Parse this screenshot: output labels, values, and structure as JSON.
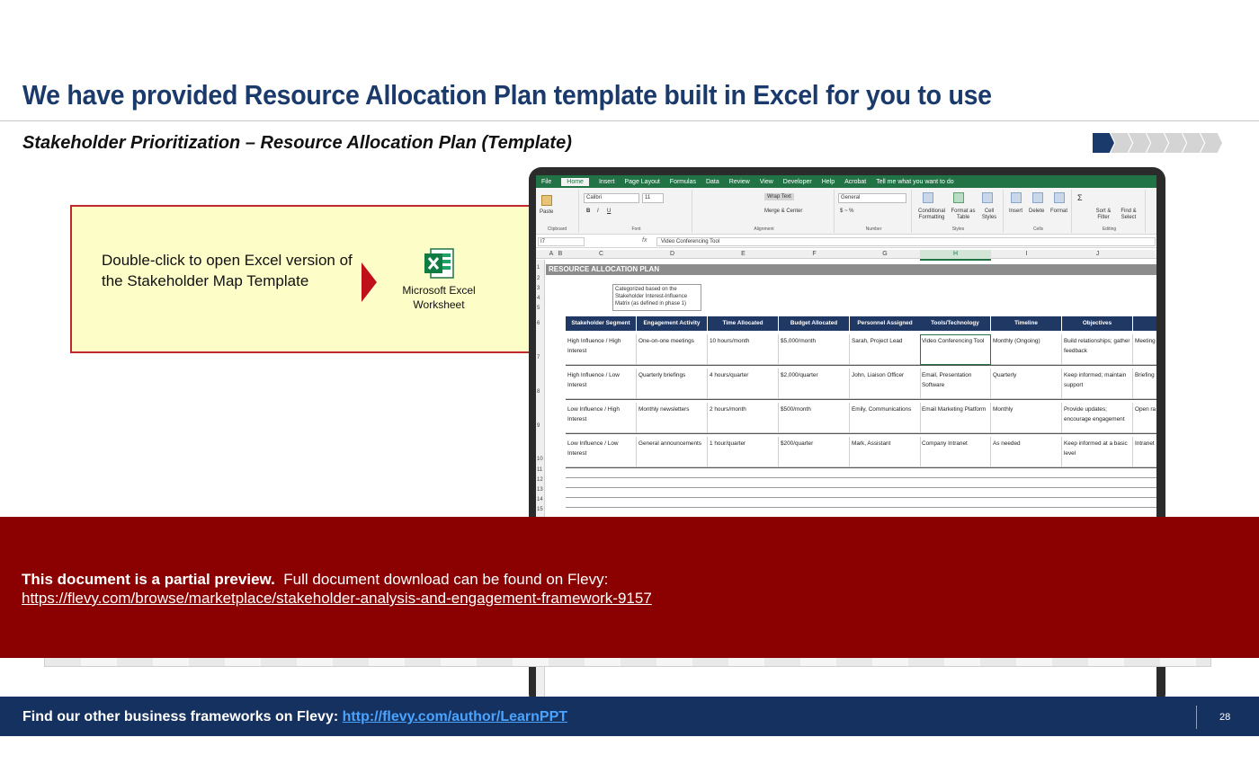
{
  "slide": {
    "title": "We have provided Resource Allocation Plan template built in Excel for you to use",
    "subtitle": "Stakeholder Prioritization – Resource Allocation Plan (Template)",
    "progress": {
      "total": 7,
      "active": 1,
      "active_color": "#1a3a6b"
    }
  },
  "callout": {
    "text": "Double-click to open Excel version of the Stakeholder Map Template",
    "file_label": "Microsoft Excel Worksheet",
    "icon": "excel-icon"
  },
  "excel": {
    "tabs": [
      "File",
      "Home",
      "Insert",
      "Page Layout",
      "Formulas",
      "Data",
      "Review",
      "View",
      "Developer",
      "Help",
      "Acrobat",
      "Tell me what you want to do"
    ],
    "ribbon": {
      "paste": "Paste",
      "clipboard": "Clipboard",
      "font_name": "Calibri",
      "font_size": "11",
      "font": "Font",
      "wrap_text": "Wrap Text",
      "merge_center": "Merge & Center",
      "alignment": "Alignment",
      "number_format": "General",
      "number": "Number",
      "conditional": "Conditional Formatting",
      "format_table": "Format as Table",
      "cell_styles": "Cell Styles",
      "styles": "Styles",
      "insert": "Insert",
      "delete": "Delete",
      "format": "Format",
      "cells": "Cells",
      "sort_filter": "Sort & Filter",
      "find_select": "Find & Select",
      "editing": "Editing"
    },
    "name_box": "I7",
    "formula": "Video Conferencing Tool",
    "columns": [
      "A",
      "B",
      "C",
      "D",
      "E",
      "F",
      "G",
      "H",
      "I",
      "J"
    ],
    "row_numbers": [
      "1",
      "2",
      "3",
      "4",
      "5",
      "6",
      "7",
      "8",
      "9",
      "10",
      "11",
      "12",
      "13",
      "14",
      "15"
    ],
    "sheet_title": "RESOURCE ALLOCATION PLAN",
    "note": "Categorized based on the Stakeholder Interest-Influence Matrix (as defined in phase 1)",
    "headers": [
      "Stakeholder Segment",
      "Engagement Activity",
      "Time Allocated",
      "Budget Allocated",
      "Personnel Assigned",
      "Tools/Technology",
      "Timeline",
      "Objectives",
      "Metrics"
    ],
    "rows": [
      [
        "High Influence / High Interest",
        "One-on-one meetings",
        "10 hours/month",
        "$5,000/month",
        "Sarah, Project Lead",
        "Video Conferencing Tool",
        "Monthly (Ongoing)",
        "Build relationships; gather feedback",
        "Meeting Satisfac"
      ],
      [
        "High Influence / Low Interest",
        "Quarterly briefings",
        "4 hours/quarter",
        "$2,000/quarter",
        "John, Liaison Officer",
        "Email, Presentation Software",
        "Quarterly",
        "Keep informed; maintain support",
        "Briefing Feedbac"
      ],
      [
        "Low Influence / High Interest",
        "Monthly newsletters",
        "2 hours/month",
        "$500/month",
        "Emily, Communications",
        "Email Marketing Platform",
        "Monthly",
        "Provide updates; encourage engagement",
        "Open ra through"
      ],
      [
        "Low Influence / Low Interest",
        "General announcements",
        "1 hour/quarter",
        "$200/quarter",
        "Mark, Assistant",
        "Company Intranet",
        "As needed",
        "Keep informed at a basic level",
        "Intranet"
      ]
    ]
  },
  "banner": {
    "bold": "This document is a partial preview.",
    "text": "Full document download can be found on Flevy:",
    "link": "https://flevy.com/browse/marketplace/stakeholder-analysis-and-engagement-framework-9157"
  },
  "footer": {
    "text": "Find our other business frameworks on Flevy:",
    "link": "http://flevy.com/author/LearnPPT",
    "page": "28"
  }
}
